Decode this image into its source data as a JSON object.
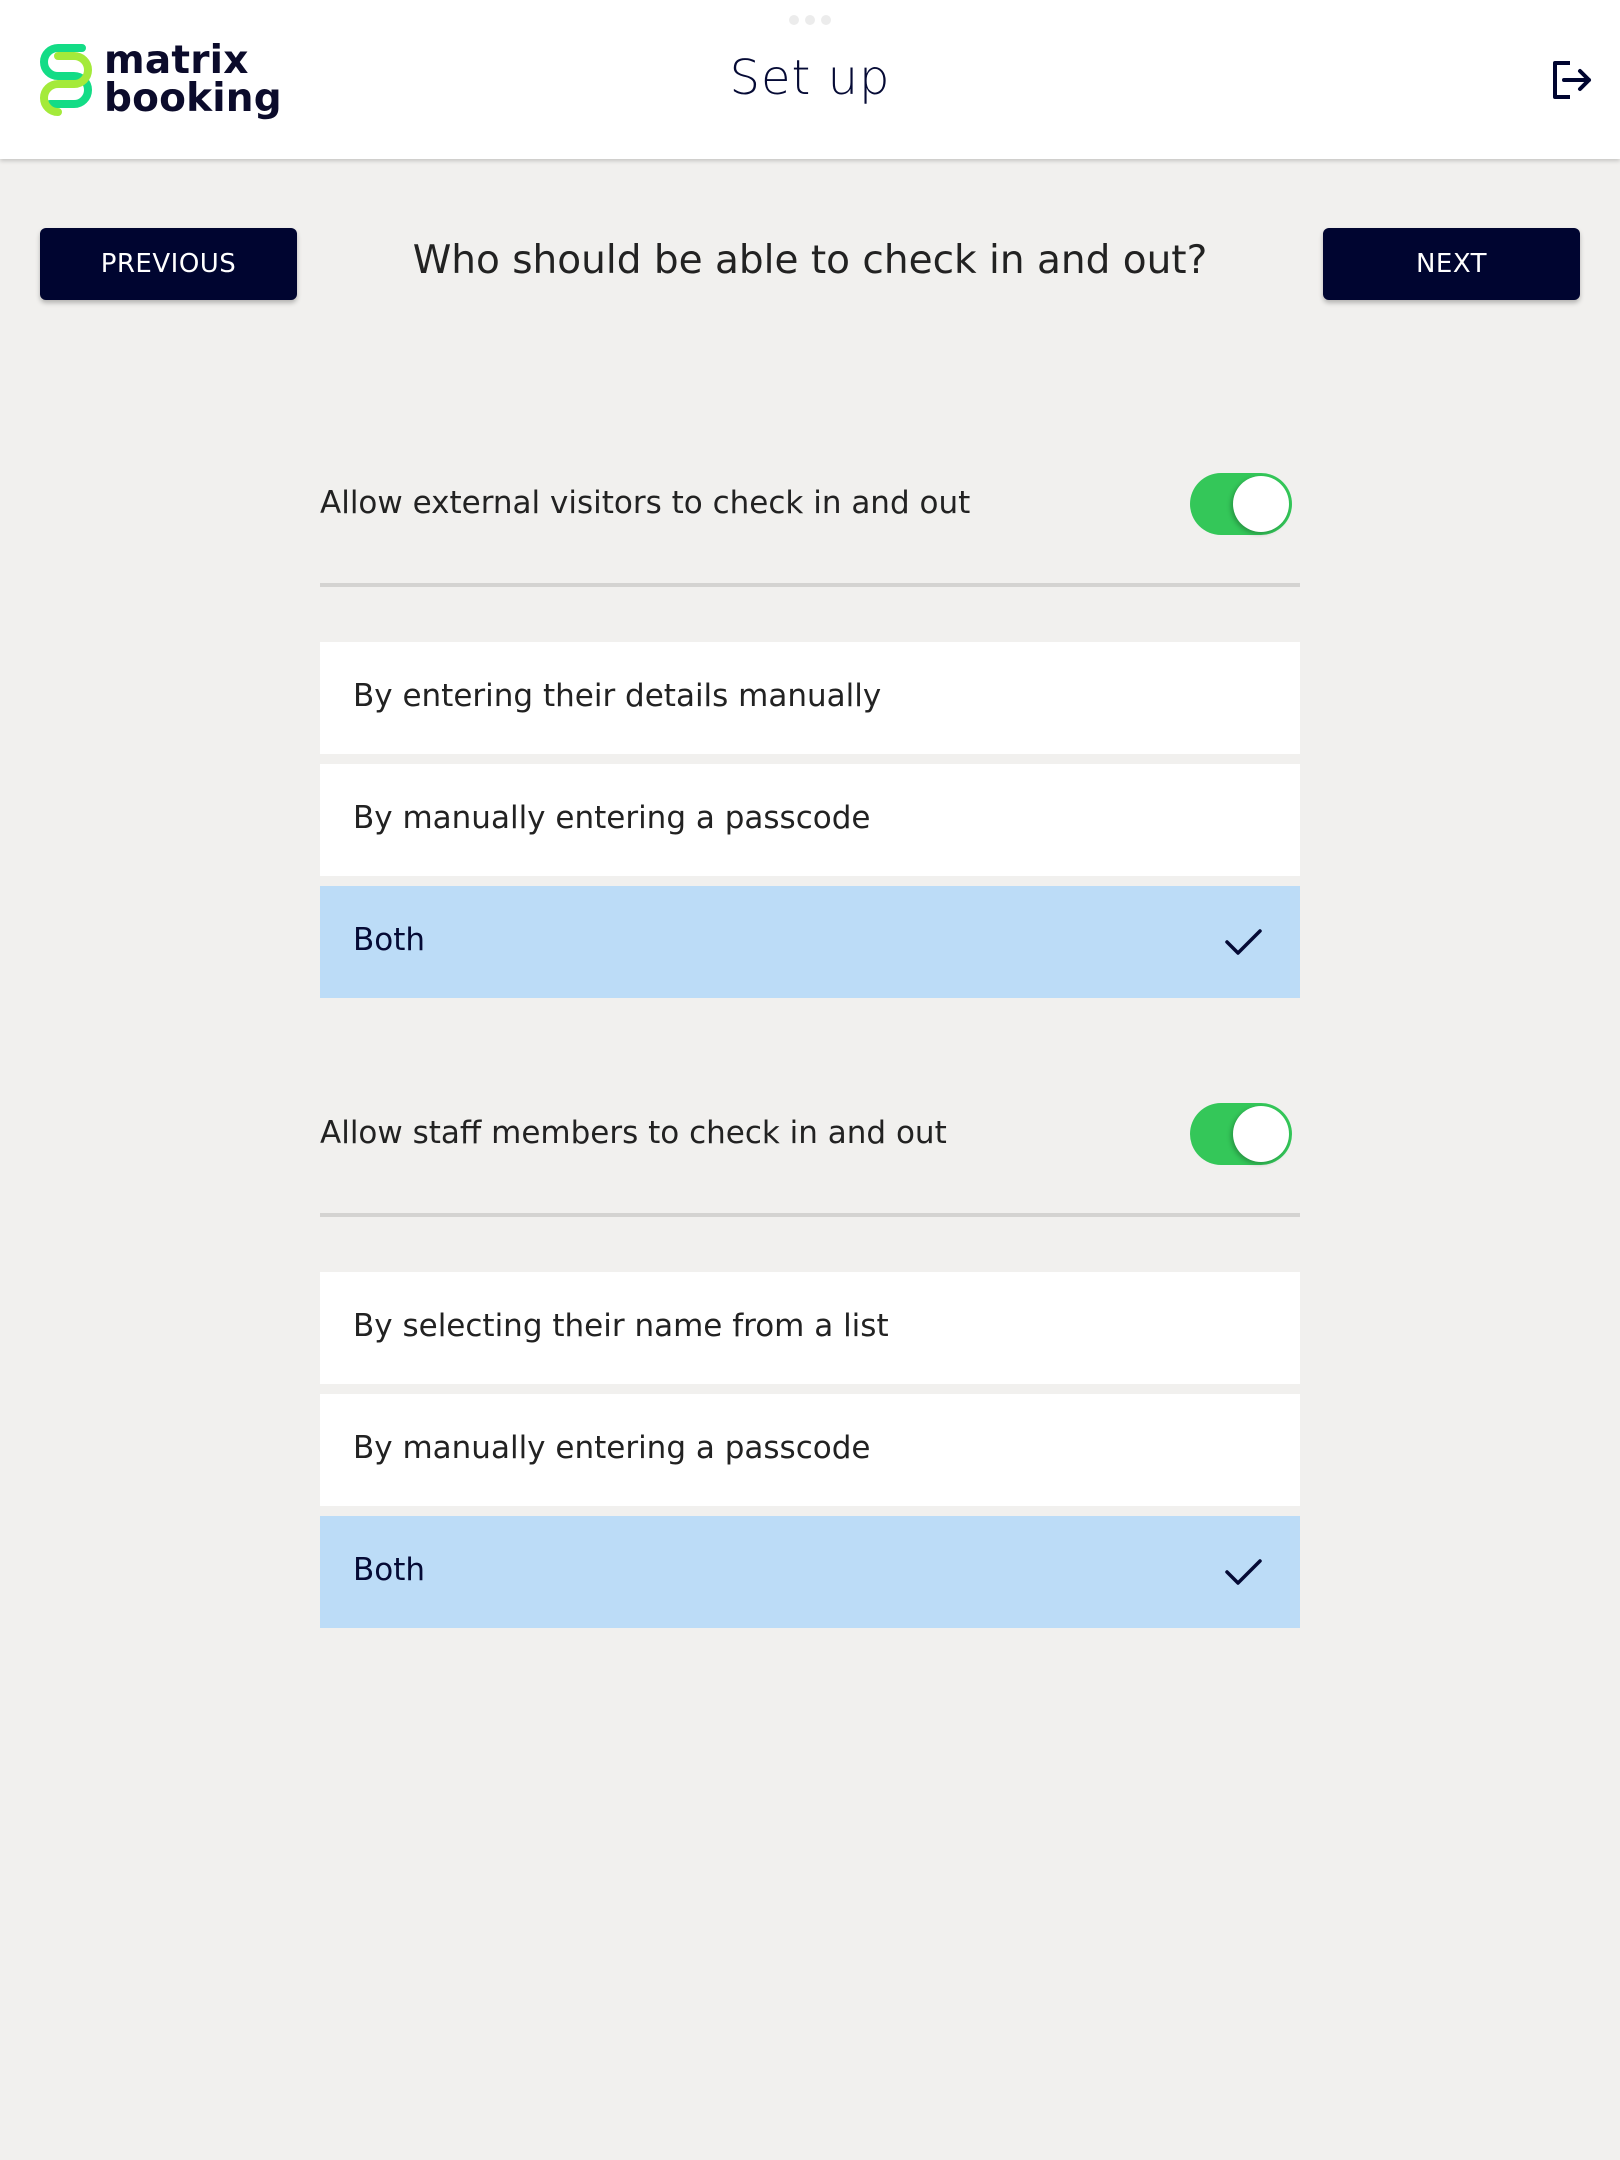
{
  "header": {
    "brand": [
      "matrix",
      "booking"
    ],
    "title": "Set up",
    "logout_icon": "logout-icon"
  },
  "nav": {
    "previous_label": "PREVIOUS",
    "next_label": "NEXT",
    "question": "Who should be able to check in and out?"
  },
  "sections": [
    {
      "toggle_label": "Allow external visitors to check in and out",
      "toggle_on": true,
      "options": [
        {
          "label": "By entering their details manually",
          "selected": false
        },
        {
          "label": "By manually entering a passcode",
          "selected": false
        },
        {
          "label": "Both",
          "selected": true
        }
      ]
    },
    {
      "toggle_label": "Allow staff members to check in and out",
      "toggle_on": true,
      "options": [
        {
          "label": "By selecting their name from a list",
          "selected": false
        },
        {
          "label": "By manually entering a passcode",
          "selected": false
        },
        {
          "label": "Both",
          "selected": true
        }
      ]
    }
  ],
  "colors": {
    "brand_navy": "#000530",
    "toggle_on": "#34c759",
    "selected_option": "#bcdcf7",
    "logo_green": "#13dc86",
    "logo_lime": "#a4ea3a"
  }
}
